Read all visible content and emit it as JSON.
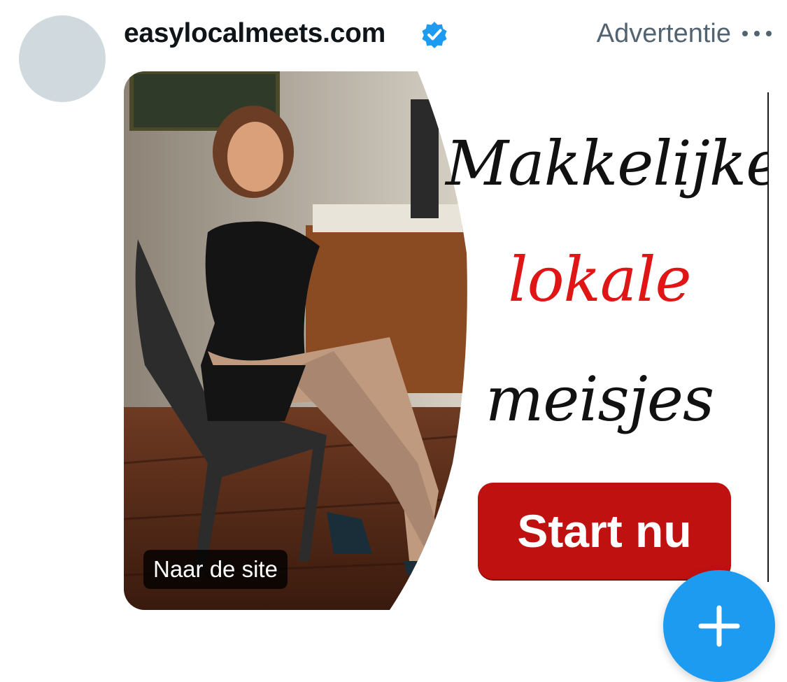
{
  "post": {
    "account_name": "easylocalmeets.com",
    "ad_label": "Advertentie",
    "icons": {
      "verified": "verified-badge-icon",
      "more": "more-options-icon",
      "compose": "plus-icon"
    },
    "colors": {
      "verified": "#1d9bf0",
      "fab": "#1d9bf0",
      "cta": "#c01111",
      "headline_red": "#e01515"
    }
  },
  "ad": {
    "headline_line1": "Makkelijke",
    "headline_line2": "lokale",
    "headline_line3": "meisjes",
    "cta_label": "Start nu",
    "site_link_label": "Naar de site"
  }
}
